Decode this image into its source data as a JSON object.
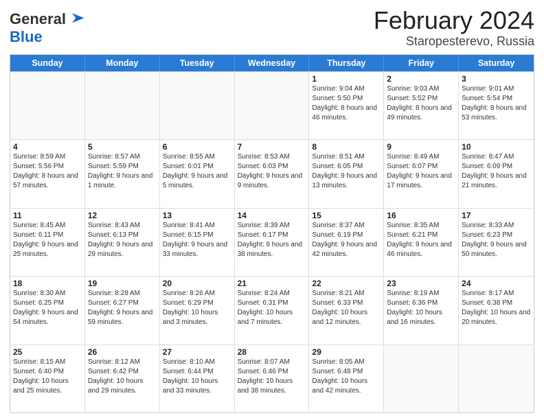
{
  "header": {
    "logo_general": "General",
    "logo_blue": "Blue",
    "title_month": "February 2024",
    "title_location": "Staropesterevo, Russia"
  },
  "calendar": {
    "days_of_week": [
      "Sunday",
      "Monday",
      "Tuesday",
      "Wednesday",
      "Thursday",
      "Friday",
      "Saturday"
    ],
    "weeks": [
      [
        {
          "day": "",
          "info": ""
        },
        {
          "day": "",
          "info": ""
        },
        {
          "day": "",
          "info": ""
        },
        {
          "day": "",
          "info": ""
        },
        {
          "day": "1",
          "info": "Sunrise: 9:04 AM\nSunset: 5:50 PM\nDaylight: 8 hours and 46 minutes."
        },
        {
          "day": "2",
          "info": "Sunrise: 9:03 AM\nSunset: 5:52 PM\nDaylight: 8 hours and 49 minutes."
        },
        {
          "day": "3",
          "info": "Sunrise: 9:01 AM\nSunset: 5:54 PM\nDaylight: 8 hours and 53 minutes."
        }
      ],
      [
        {
          "day": "4",
          "info": "Sunrise: 8:59 AM\nSunset: 5:56 PM\nDaylight: 8 hours and 57 minutes."
        },
        {
          "day": "5",
          "info": "Sunrise: 8:57 AM\nSunset: 5:59 PM\nDaylight: 9 hours and 1 minute."
        },
        {
          "day": "6",
          "info": "Sunrise: 8:55 AM\nSunset: 6:01 PM\nDaylight: 9 hours and 5 minutes."
        },
        {
          "day": "7",
          "info": "Sunrise: 8:53 AM\nSunset: 6:03 PM\nDaylight: 9 hours and 9 minutes."
        },
        {
          "day": "8",
          "info": "Sunrise: 8:51 AM\nSunset: 6:05 PM\nDaylight: 9 hours and 13 minutes."
        },
        {
          "day": "9",
          "info": "Sunrise: 8:49 AM\nSunset: 6:07 PM\nDaylight: 9 hours and 17 minutes."
        },
        {
          "day": "10",
          "info": "Sunrise: 8:47 AM\nSunset: 6:09 PM\nDaylight: 9 hours and 21 minutes."
        }
      ],
      [
        {
          "day": "11",
          "info": "Sunrise: 8:45 AM\nSunset: 6:11 PM\nDaylight: 9 hours and 25 minutes."
        },
        {
          "day": "12",
          "info": "Sunrise: 8:43 AM\nSunset: 6:13 PM\nDaylight: 9 hours and 29 minutes."
        },
        {
          "day": "13",
          "info": "Sunrise: 8:41 AM\nSunset: 6:15 PM\nDaylight: 9 hours and 33 minutes."
        },
        {
          "day": "14",
          "info": "Sunrise: 8:39 AM\nSunset: 6:17 PM\nDaylight: 9 hours and 38 minutes."
        },
        {
          "day": "15",
          "info": "Sunrise: 8:37 AM\nSunset: 6:19 PM\nDaylight: 9 hours and 42 minutes."
        },
        {
          "day": "16",
          "info": "Sunrise: 8:35 AM\nSunset: 6:21 PM\nDaylight: 9 hours and 46 minutes."
        },
        {
          "day": "17",
          "info": "Sunrise: 8:33 AM\nSunset: 6:23 PM\nDaylight: 9 hours and 50 minutes."
        }
      ],
      [
        {
          "day": "18",
          "info": "Sunrise: 8:30 AM\nSunset: 6:25 PM\nDaylight: 9 hours and 54 minutes."
        },
        {
          "day": "19",
          "info": "Sunrise: 8:28 AM\nSunset: 6:27 PM\nDaylight: 9 hours and 59 minutes."
        },
        {
          "day": "20",
          "info": "Sunrise: 8:26 AM\nSunset: 6:29 PM\nDaylight: 10 hours and 3 minutes."
        },
        {
          "day": "21",
          "info": "Sunrise: 8:24 AM\nSunset: 6:31 PM\nDaylight: 10 hours and 7 minutes."
        },
        {
          "day": "22",
          "info": "Sunrise: 8:21 AM\nSunset: 6:33 PM\nDaylight: 10 hours and 12 minutes."
        },
        {
          "day": "23",
          "info": "Sunrise: 8:19 AM\nSunset: 6:36 PM\nDaylight: 10 hours and 16 minutes."
        },
        {
          "day": "24",
          "info": "Sunrise: 8:17 AM\nSunset: 6:38 PM\nDaylight: 10 hours and 20 minutes."
        }
      ],
      [
        {
          "day": "25",
          "info": "Sunrise: 8:15 AM\nSunset: 6:40 PM\nDaylight: 10 hours and 25 minutes."
        },
        {
          "day": "26",
          "info": "Sunrise: 8:12 AM\nSunset: 6:42 PM\nDaylight: 10 hours and 29 minutes."
        },
        {
          "day": "27",
          "info": "Sunrise: 8:10 AM\nSunset: 6:44 PM\nDaylight: 10 hours and 33 minutes."
        },
        {
          "day": "28",
          "info": "Sunrise: 8:07 AM\nSunset: 6:46 PM\nDaylight: 10 hours and 38 minutes."
        },
        {
          "day": "29",
          "info": "Sunrise: 8:05 AM\nSunset: 6:48 PM\nDaylight: 10 hours and 42 minutes."
        },
        {
          "day": "",
          "info": ""
        },
        {
          "day": "",
          "info": ""
        }
      ]
    ]
  }
}
